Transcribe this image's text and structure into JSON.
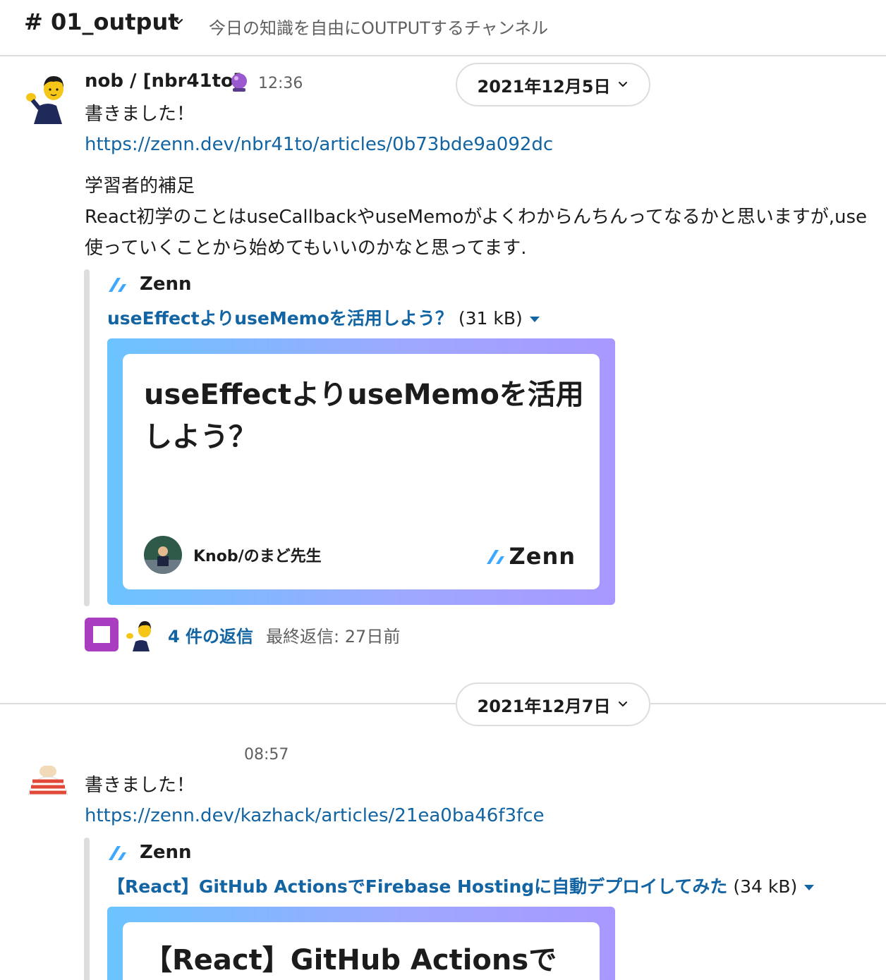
{
  "header": {
    "channel_name": "# 01_output",
    "topic": "今日の知識を自由にOUTPUTするチャンネル"
  },
  "messages": [
    {
      "author": "nob / [nbr41to]",
      "status_emoji": "crystal-ball",
      "time": "12:36",
      "text": "書きました！",
      "link": "https://zenn.dev/nbr41to/articles/0b73bde9a092dc",
      "body_lines": [
        "学習者的補足",
        "React初学のことはuseCallbackやuseMemoがよくわからんちんってなるかと思いますが,use",
        "使っていくことから始めてもいいのかなと思ってます."
      ],
      "unfurl": {
        "service": "Zenn",
        "title": "useEffectよりuseMemoを活用しよう？",
        "size": "(31 kB)",
        "card_title_lines": [
          "useEffectよりuseMemoを活用",
          "しよう？"
        ],
        "card_author": "Knob/のまど先生",
        "card_brand": "Zenn"
      },
      "thread": {
        "replies": "4 件の返信",
        "last_reply": "最終返信: 27日前"
      }
    },
    {
      "time": "08:57",
      "text": "書きました！",
      "link": "https://zenn.dev/kazhack/articles/21ea0ba46f3fce",
      "unfurl": {
        "service": "Zenn",
        "title": "【React】GitHub ActionsでFirebase Hostingに自動デプロイしてみた",
        "size": "(34 kB)",
        "card_title_lines": [
          "【React】GitHub Actionsで"
        ]
      }
    }
  ],
  "date_dividers": [
    "2021年12月5日",
    "2021年12月7日"
  ],
  "colors": {
    "link": "#1264a3",
    "text": "#1d1c1d",
    "muted": "#616061",
    "zenn_blue": "#3ea8ff",
    "thread_avatar_purple": "#a83dc0"
  }
}
